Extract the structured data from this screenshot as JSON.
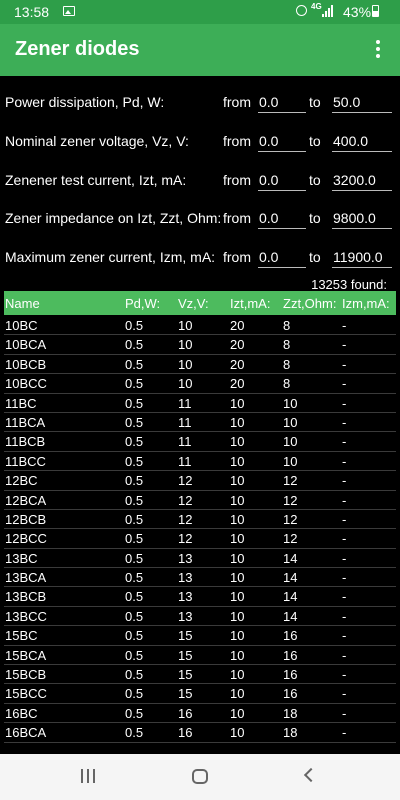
{
  "status_bar": {
    "time": "13:58",
    "network": "4G",
    "battery": "43%",
    "icons": [
      "gallery-icon",
      "alarm-icon",
      "signal-icon",
      "battery-icon"
    ]
  },
  "app_bar": {
    "title": "Zener diodes",
    "menu_icon": "more-vert-icon",
    "color": "#3dae57"
  },
  "filters": [
    {
      "label": "Power dissipation, Pd, W:",
      "from_label": "from",
      "from": "0.0",
      "to_label": "to",
      "to": "50.0"
    },
    {
      "label": "Nominal zener voltage, Vz, V:",
      "from_label": "from",
      "from": "0.0",
      "to_label": "to",
      "to": "400.0"
    },
    {
      "label": "Zenener test current, Izt, mA:",
      "from_label": "from",
      "from": "0.0",
      "to_label": "to",
      "to": "3200.0"
    },
    {
      "label": "Zener impedance on Izt, Zzt, Ohm:",
      "from_label": "from",
      "from": "0.0",
      "to_label": "to",
      "to": "9800.0"
    },
    {
      "label": "Maximum zener current, Izm, mA:",
      "from_label": "from",
      "from": "0.0",
      "to_label": "to",
      "to": "11900.0"
    }
  ],
  "found": "13253 found:",
  "table": {
    "headers": [
      "Name",
      "Pd,W:",
      "Vz,V:",
      "Izt,mA:",
      "Zzt,Ohm:",
      "Izm,mA:"
    ],
    "rows": [
      [
        "10BC",
        "0.5",
        "10",
        "20",
        "8",
        "-"
      ],
      [
        "10BCA",
        "0.5",
        "10",
        "20",
        "8",
        "-"
      ],
      [
        "10BCB",
        "0.5",
        "10",
        "20",
        "8",
        "-"
      ],
      [
        "10BCC",
        "0.5",
        "10",
        "20",
        "8",
        "-"
      ],
      [
        "11BC",
        "0.5",
        "11",
        "10",
        "10",
        "-"
      ],
      [
        "11BCA",
        "0.5",
        "11",
        "10",
        "10",
        "-"
      ],
      [
        "11BCB",
        "0.5",
        "11",
        "10",
        "10",
        "-"
      ],
      [
        "11BCC",
        "0.5",
        "11",
        "10",
        "10",
        "-"
      ],
      [
        "12BC",
        "0.5",
        "12",
        "10",
        "12",
        "-"
      ],
      [
        "12BCA",
        "0.5",
        "12",
        "10",
        "12",
        "-"
      ],
      [
        "12BCB",
        "0.5",
        "12",
        "10",
        "12",
        "-"
      ],
      [
        "12BCC",
        "0.5",
        "12",
        "10",
        "12",
        "-"
      ],
      [
        "13BC",
        "0.5",
        "13",
        "10",
        "14",
        "-"
      ],
      [
        "13BCA",
        "0.5",
        "13",
        "10",
        "14",
        "-"
      ],
      [
        "13BCB",
        "0.5",
        "13",
        "10",
        "14",
        "-"
      ],
      [
        "13BCC",
        "0.5",
        "13",
        "10",
        "14",
        "-"
      ],
      [
        "15BC",
        "0.5",
        "15",
        "10",
        "16",
        "-"
      ],
      [
        "15BCA",
        "0.5",
        "15",
        "10",
        "16",
        "-"
      ],
      [
        "15BCB",
        "0.5",
        "15",
        "10",
        "16",
        "-"
      ],
      [
        "15BCC",
        "0.5",
        "15",
        "10",
        "16",
        "-"
      ],
      [
        "16BC",
        "0.5",
        "16",
        "10",
        "18",
        "-"
      ],
      [
        "16BCA",
        "0.5",
        "16",
        "10",
        "18",
        "-"
      ]
    ]
  },
  "nav_bar": {
    "icons": [
      "recent-apps-icon",
      "home-icon",
      "back-icon"
    ]
  },
  "colors": {
    "status_bar": "#2e9e49",
    "app_bar": "#3dae57",
    "table_header": "#4dbb5e",
    "background": "#000000"
  }
}
